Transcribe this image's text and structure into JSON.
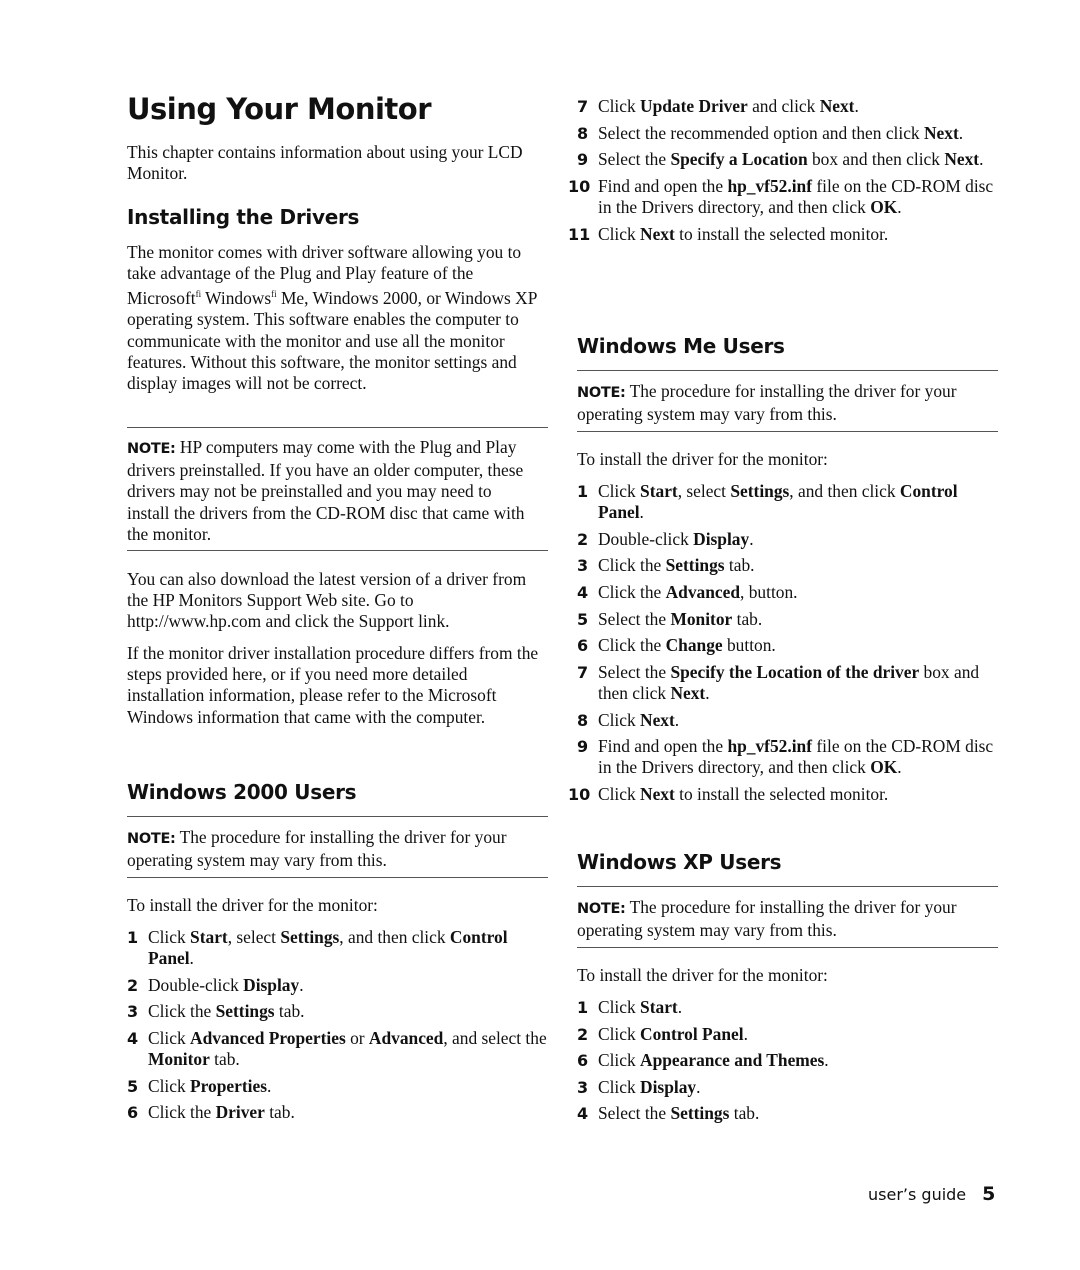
{
  "page": {
    "title": "Using Your Monitor",
    "intro": "This chapter contains information about using your LCD Monitor."
  },
  "installing": {
    "heading": "Installing the Drivers",
    "body": "The monitor comes with driver software allowing you to take advantage of the Plug and Play feature of the Microsoft® Windows® Me, Windows 2000, or Windows XP operating system. This software enables the computer to communicate with the monitor and use all the monitor features. Without this software, the monitor settings and display images will not be correct.",
    "body_glyph_note": "fi",
    "note_label": "NOTE:",
    "note_text": " HP computers may come with the Plug and Play drivers preinstalled. If you have an older computer, these drivers may not be preinstalled and you may need to install the drivers from the CD-ROM disc that came with the monitor.",
    "download_text": "You can also download the latest version of a driver from the HP Monitors Support Web site. Go to http://www.hp.com and click the Support link.",
    "differs_text": "If the monitor driver installation procedure differs from the steps provided here, or if you need more detailed installation information, please refer to the Microsoft Windows information that came with the computer."
  },
  "win2000": {
    "heading": "Windows 2000 Users",
    "note_label": "NOTE:",
    "note_text": " The procedure for installing the driver for your operating system may vary from this.",
    "lead": "To install the driver for the monitor:",
    "steps": [
      {
        "num": "1",
        "parts": [
          [
            "Click ",
            false
          ],
          [
            "Start",
            true
          ],
          [
            ", select ",
            false
          ],
          [
            "Settings",
            true
          ],
          [
            ", and then click ",
            false
          ],
          [
            "Control Panel",
            true
          ],
          [
            ".",
            false
          ]
        ]
      },
      {
        "num": "2",
        "parts": [
          [
            "Double-click ",
            false
          ],
          [
            "Display",
            true
          ],
          [
            ".",
            false
          ]
        ]
      },
      {
        "num": "3",
        "parts": [
          [
            "Click the ",
            false
          ],
          [
            "Settings",
            true
          ],
          [
            " tab.",
            false
          ]
        ]
      },
      {
        "num": "4",
        "parts": [
          [
            "Click ",
            false
          ],
          [
            "Advanced Properties",
            true
          ],
          [
            " or ",
            false
          ],
          [
            "Advanced",
            true
          ],
          [
            ", and select the ",
            false
          ],
          [
            "Monitor",
            true
          ],
          [
            " tab.",
            false
          ]
        ]
      },
      {
        "num": "5",
        "parts": [
          [
            "Click ",
            false
          ],
          [
            "Properties",
            true
          ],
          [
            ".",
            false
          ]
        ]
      },
      {
        "num": "6",
        "parts": [
          [
            "Click the ",
            false
          ],
          [
            "Driver",
            true
          ],
          [
            " tab.",
            false
          ]
        ]
      },
      {
        "num": "7",
        "parts": [
          [
            "Click ",
            false
          ],
          [
            "Update Driver",
            true
          ],
          [
            " and click ",
            false
          ],
          [
            "Next",
            true
          ],
          [
            ".",
            false
          ]
        ]
      },
      {
        "num": "8",
        "parts": [
          [
            "Select the recommended option and then click ",
            false
          ],
          [
            "Next",
            true
          ],
          [
            ".",
            false
          ]
        ]
      },
      {
        "num": "9",
        "parts": [
          [
            "Select the ",
            false
          ],
          [
            "Specify a Location",
            true
          ],
          [
            " box and then click ",
            false
          ],
          [
            "Next",
            true
          ],
          [
            ".",
            false
          ]
        ]
      },
      {
        "num": "10",
        "parts": [
          [
            "Find and open the ",
            false
          ],
          [
            "hp_vf52.inf",
            true
          ],
          [
            " file on the CD-ROM disc in the Drivers directory, and then click ",
            false
          ],
          [
            "OK",
            true
          ],
          [
            ".",
            false
          ]
        ]
      },
      {
        "num": "11",
        "parts": [
          [
            "Click ",
            false
          ],
          [
            "Next",
            true
          ],
          [
            " to install the selected monitor.",
            false
          ]
        ]
      }
    ]
  },
  "winme": {
    "heading": "Windows Me Users",
    "note_label": "NOTE:",
    "note_text": " The procedure for installing the driver for your operating system may vary from this.",
    "lead": "To install the driver for the monitor:",
    "steps": [
      {
        "num": "1",
        "parts": [
          [
            "Click ",
            false
          ],
          [
            "Start",
            true
          ],
          [
            ", select ",
            false
          ],
          [
            "Settings",
            true
          ],
          [
            ", and then click ",
            false
          ],
          [
            "Control Panel",
            true
          ],
          [
            ".",
            false
          ]
        ]
      },
      {
        "num": "2",
        "parts": [
          [
            "Double-click ",
            false
          ],
          [
            "Display",
            true
          ],
          [
            ".",
            false
          ]
        ]
      },
      {
        "num": "3",
        "parts": [
          [
            "Click the ",
            false
          ],
          [
            "Settings",
            true
          ],
          [
            " tab.",
            false
          ]
        ]
      },
      {
        "num": "4",
        "parts": [
          [
            "Click the ",
            false
          ],
          [
            "Advanced",
            true
          ],
          [
            ", button.",
            false
          ]
        ]
      },
      {
        "num": "5",
        "parts": [
          [
            "Select the ",
            false
          ],
          [
            "Monitor",
            true
          ],
          [
            " tab.",
            false
          ]
        ]
      },
      {
        "num": "6",
        "parts": [
          [
            "Click the ",
            false
          ],
          [
            "Change",
            true
          ],
          [
            " button.",
            false
          ]
        ]
      },
      {
        "num": "7",
        "parts": [
          [
            "Select the ",
            false
          ],
          [
            "Specify the Location of the driver",
            true
          ],
          [
            " box and then click ",
            false
          ],
          [
            "Next",
            true
          ],
          [
            ".",
            false
          ]
        ]
      },
      {
        "num": "8",
        "parts": [
          [
            "Click ",
            false
          ],
          [
            "Next",
            true
          ],
          [
            ".",
            false
          ]
        ]
      },
      {
        "num": "9",
        "parts": [
          [
            "Find and open the ",
            false
          ],
          [
            "hp_vf52.inf",
            true
          ],
          [
            " file on the CD-ROM disc in the Drivers directory, and then click ",
            false
          ],
          [
            "OK",
            true
          ],
          [
            ".",
            false
          ]
        ]
      },
      {
        "num": "10",
        "parts": [
          [
            "Click ",
            false
          ],
          [
            "Next",
            true
          ],
          [
            " to install the selected monitor.",
            false
          ]
        ]
      }
    ]
  },
  "winxp": {
    "heading": "Windows XP Users",
    "note_label": "NOTE:",
    "note_text": " The procedure for installing the driver for your operating system may vary from this.",
    "lead": "To install the driver for the monitor:",
    "steps": [
      {
        "num": "1",
        "parts": [
          [
            "Click ",
            false
          ],
          [
            "Start",
            true
          ],
          [
            ".",
            false
          ]
        ]
      },
      {
        "num": "2",
        "parts": [
          [
            "Click ",
            false
          ],
          [
            "Control Panel",
            true
          ],
          [
            ".",
            false
          ]
        ]
      },
      {
        "num": "6",
        "parts": [
          [
            "Click ",
            false
          ],
          [
            "Appearance and Themes",
            true
          ],
          [
            ".",
            false
          ]
        ]
      },
      {
        "num": "3",
        "parts": [
          [
            "Click ",
            false
          ],
          [
            "Display",
            true
          ],
          [
            ".",
            false
          ]
        ]
      },
      {
        "num": "4",
        "parts": [
          [
            "Select the ",
            false
          ],
          [
            "Settings",
            true
          ],
          [
            " tab.",
            false
          ]
        ]
      }
    ]
  },
  "footer": {
    "label": "user’s guide",
    "page_number": "5"
  }
}
